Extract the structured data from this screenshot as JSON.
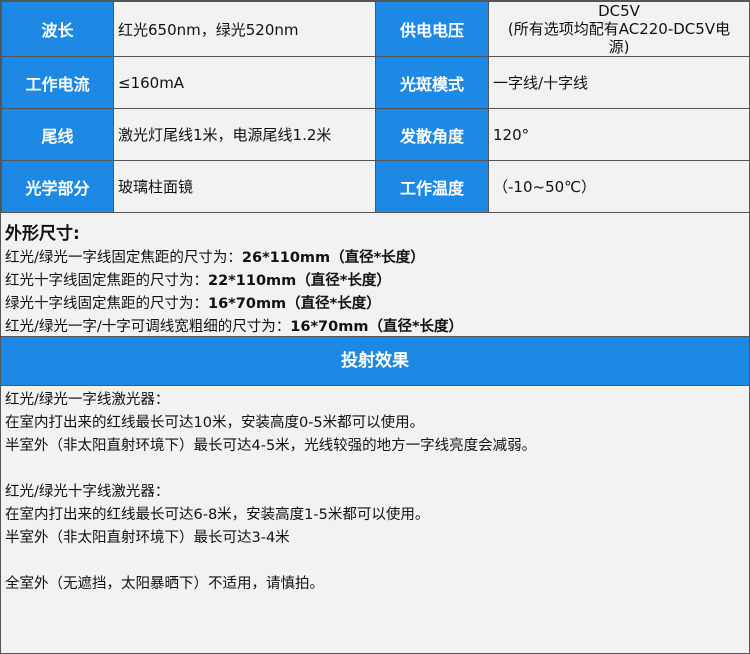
{
  "specs": [
    {
      "label1": "波长",
      "value1": "红光650nm，绿光520nm",
      "label2": "供电电压",
      "value2_lines": [
        "DC5V",
        "(所有选项均配有AC220-DC5V电",
        "源)"
      ]
    },
    {
      "label1": "工作电流",
      "value1": "≤160mA",
      "label2": "光斑模式",
      "value2": "一字线/十字线"
    },
    {
      "label1": "尾线",
      "value1": "激光灯尾线1米，电源尾线1.2米",
      "label2": "发散角度",
      "value2": "120°"
    },
    {
      "label1": "光学部分",
      "value1": "玻璃柱面镜",
      "label2": "工作温度",
      "value2": "（-10~50℃）"
    }
  ],
  "dimensions": {
    "title": "外形尺寸:",
    "items": [
      {
        "text": "红光/绿光一字线固定焦距的尺寸为：",
        "bold": "26*110mm（直径*长度）"
      },
      {
        "text": "红光十字线固定焦距的尺寸为：",
        "bold": "22*110mm（直径*长度）"
      },
      {
        "text": "绿光十字线固定焦距的尺寸为：",
        "bold": "16*70mm（直径*长度）"
      },
      {
        "text": "红光/绿光一字/十字可调线宽粗细的尺寸为：",
        "bold": "16*70mm（直径*长度）"
      }
    ]
  },
  "projection": {
    "title": "投射效果",
    "group1": [
      "红光/绿光一字线激光器：",
      "在室内打出来的红线最长可达10米，安装高度0-5米都可以使用。",
      "半室外（非太阳直射环境下）最长可达4-5米，光线较强的地方一字线亮度会减弱。"
    ],
    "group2": [
      "红光/绿光十字线激光器：",
      "在室内打出来的红线最长可达6-8米，安装高度1-5米都可以使用。",
      "半室外（非太阳直射环境下）最长可达3-4米"
    ],
    "note": "全室外（无遮挡，太阳暴晒下）不适用，请慎拍。"
  }
}
